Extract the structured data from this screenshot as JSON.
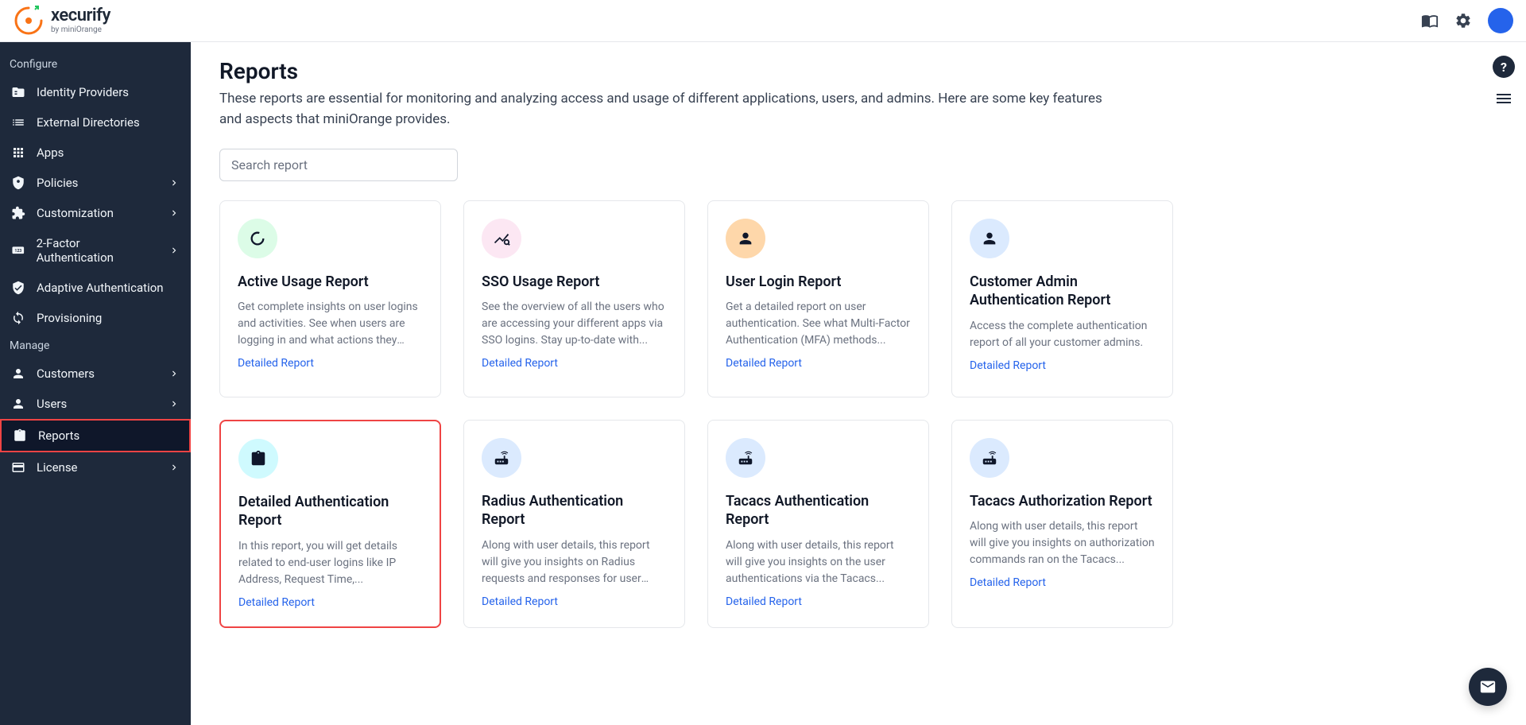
{
  "brand": {
    "name": "xecurify",
    "sub": "by miniOrange"
  },
  "sidebar": {
    "section_configure": "Configure",
    "section_manage": "Manage",
    "items": {
      "idp": "Identity Providers",
      "extdir": "External Directories",
      "apps": "Apps",
      "policies": "Policies",
      "customization": "Customization",
      "twofa": "2-Factor Authentication",
      "adaptive": "Adaptive Authentication",
      "provisioning": "Provisioning",
      "customers": "Customers",
      "users": "Users",
      "reports": "Reports",
      "license": "License"
    }
  },
  "page": {
    "title": "Reports",
    "desc": "These reports are essential for monitoring and analyzing access and usage of different applications, users, and admins. Here are some key features and aspects that miniOrange provides.",
    "search_placeholder": "Search report",
    "detailed_link": "Detailed Report"
  },
  "cards": [
    {
      "title": "Active Usage Report",
      "desc": "Get complete insights on user logins and activities. See when users are logging in and what actions they are...",
      "icon": "progress",
      "bg": "ic-green"
    },
    {
      "title": "SSO Usage Report",
      "desc": "See the overview of all the users who are accessing your different apps via SSO logins. Stay up-to-date with...",
      "icon": "analytics",
      "bg": "ic-pink"
    },
    {
      "title": "User Login Report",
      "desc": "Get a detailed report on user authentication. See what Multi-Factor Authentication (MFA) methods...",
      "icon": "user",
      "bg": "ic-orange"
    },
    {
      "title": "Customer Admin Authentication Report",
      "desc": "Access the complete authentication report of all your customer admins.",
      "icon": "user",
      "bg": "ic-blue"
    },
    {
      "title": "Detailed Authentication Report",
      "desc": "In this report, you will get details related to end-user logins like IP Address, Request Time,...",
      "icon": "clipboard",
      "bg": "ic-cyan",
      "highlight": true
    },
    {
      "title": "Radius Authentication Report",
      "desc": "Along with user details, this report will give you insights on Radius requests and responses for user logins via the...",
      "icon": "router",
      "bg": "ic-blue"
    },
    {
      "title": "Tacacs Authentication Report",
      "desc": "Along with user details, this report will give you insights on the user authentications via the Tacacs...",
      "icon": "router",
      "bg": "ic-blue"
    },
    {
      "title": "Tacacs Authorization Report",
      "desc": "Along with user details, this report will give you insights on authorization commands ran on the Tacacs...",
      "icon": "router",
      "bg": "ic-blue"
    }
  ]
}
